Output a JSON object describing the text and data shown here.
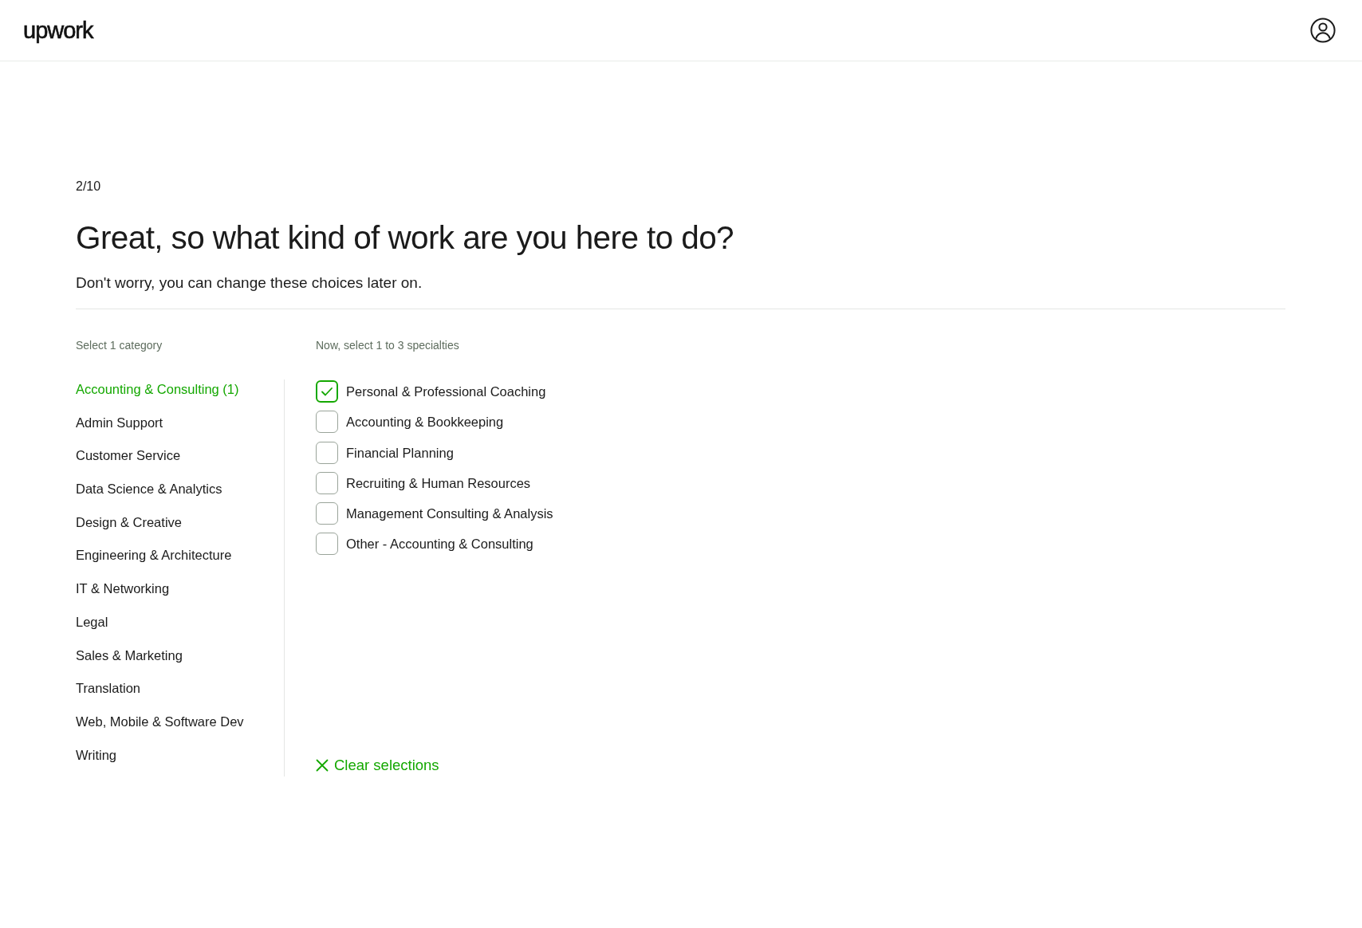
{
  "header": {
    "logo": "upwork"
  },
  "step": "2/10",
  "title": "Great, so what kind of work are you here to do?",
  "subtitle": "Don't worry, you can change these choices later on.",
  "categories": {
    "heading": "Select 1 category",
    "items": [
      {
        "label": "Accounting & Consulting (1)",
        "selected": true
      },
      {
        "label": "Admin Support",
        "selected": false
      },
      {
        "label": "Customer Service",
        "selected": false
      },
      {
        "label": "Data Science & Analytics",
        "selected": false
      },
      {
        "label": "Design & Creative",
        "selected": false
      },
      {
        "label": "Engineering & Architecture",
        "selected": false
      },
      {
        "label": "IT & Networking",
        "selected": false
      },
      {
        "label": "Legal",
        "selected": false
      },
      {
        "label": "Sales & Marketing",
        "selected": false
      },
      {
        "label": "Translation",
        "selected": false
      },
      {
        "label": "Web, Mobile & Software Dev",
        "selected": false
      },
      {
        "label": "Writing",
        "selected": false
      }
    ]
  },
  "specialties": {
    "heading": "Now, select 1 to 3 specialties",
    "items": [
      {
        "label": "Personal & Professional Coaching",
        "checked": true
      },
      {
        "label": "Accounting & Bookkeeping",
        "checked": false
      },
      {
        "label": "Financial Planning",
        "checked": false
      },
      {
        "label": "Recruiting & Human Resources",
        "checked": false
      },
      {
        "label": "Management Consulting & Analysis",
        "checked": false
      },
      {
        "label": "Other - Accounting & Consulting",
        "checked": false
      }
    ]
  },
  "clear_button": {
    "label": "Clear selections"
  }
}
